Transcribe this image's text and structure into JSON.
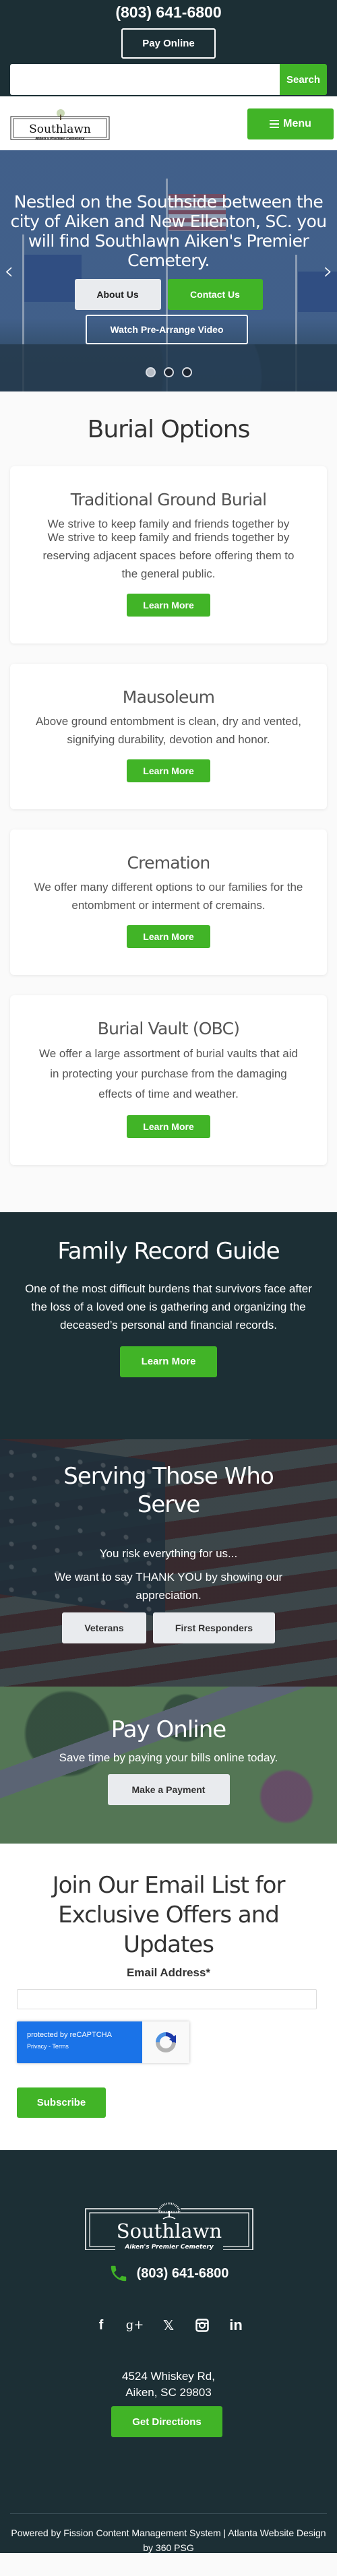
{
  "colors": {
    "dark_bg": "#1c2f35",
    "accent_green": "#41b427",
    "light_button": "#e9ebee",
    "recaptcha_blue": "#1a73e8"
  },
  "topbar": {
    "phone": "(803) 641-6800",
    "pay_online_label": "Pay Online",
    "search_placeholder": "",
    "search_value": "",
    "search_button_label": "Search"
  },
  "nav": {
    "logo_name": "Southlawn",
    "logo_tagline": "Aiken's Premier Cemetery",
    "menu_label": "Menu"
  },
  "hero": {
    "headline": "Nestled on the Southside between the city of Aiken and New Ellenton, SC. you will find Southlawn Aiken's Premier Cemetery.",
    "about_label": "About Us",
    "contact_label": "Contact Us",
    "video_label": "Watch Pre-Arrange Video",
    "prev_icon": "chevron-left-icon",
    "next_icon": "chevron-right-icon",
    "slides_total": 3,
    "active_slide": 1
  },
  "burial": {
    "title": "Burial Options",
    "cards": [
      {
        "title": "Traditional Ground Burial",
        "text": "We strive to keep family and friends together by reserving adjacent spaces before offering them to the general public.",
        "button": "Learn More"
      },
      {
        "title": "Mausoleum",
        "text": "Above ground entombment is clean, dry and vented, signifying durability, devotion and honor.",
        "button": "Learn More"
      },
      {
        "title": "Cremation",
        "text": "We offer many different options to our families for the entombment or interment of cremains.",
        "button": "Learn More"
      },
      {
        "title": "Burial Vault (OBC)",
        "text": "We offer a large assortment of burial vaults that aid in protecting your purchase from the damaging effects of time and weather.",
        "button": "Learn More"
      }
    ]
  },
  "family": {
    "title": "Family Record Guide",
    "text": "One of the most difficult burdens that survivors face after the loss of a loved one is gathering and organizing the deceased’s personal and financial records.",
    "button": "Learn More"
  },
  "serving": {
    "title": "Serving Those Who Serve",
    "line1": "You risk everything for us...",
    "line2": "We want to say THANK YOU by showing our appreciation.",
    "veterans_label": "Veterans",
    "first_responders_label": "First Responders"
  },
  "pay": {
    "title": "Pay Online",
    "text": "Save time by paying your bills online today.",
    "button": "Make a Payment"
  },
  "email": {
    "title": "Join Our Email List for Exclusive Offers and Updates",
    "label": "Email Address*",
    "value": "",
    "placeholder": "",
    "recaptcha_text": "protected by reCAPTCHA",
    "recaptcha_links": "Privacy - Terms",
    "subscribe_label": "Subscribe"
  },
  "footer": {
    "logo_name": "Southlawn",
    "logo_tagline": "Aiken's Premier Cemetery",
    "phone": "(803) 641-6800",
    "social": [
      {
        "name": "facebook-icon",
        "glyph": "f"
      },
      {
        "name": "google-plus-icon",
        "glyph": "g+"
      },
      {
        "name": "x-twitter-icon",
        "glyph": "𝕏"
      },
      {
        "name": "instagram-icon",
        "glyph": ""
      },
      {
        "name": "linkedin-icon",
        "glyph": "in"
      }
    ],
    "address_line1": "4524 Whiskey Rd,",
    "address_line2": "Aiken, SC 29803",
    "directions_label": "Get Directions",
    "powered_by": "Powered by Fission Content Management System | Atlanta Website Design by 360 PSG"
  }
}
